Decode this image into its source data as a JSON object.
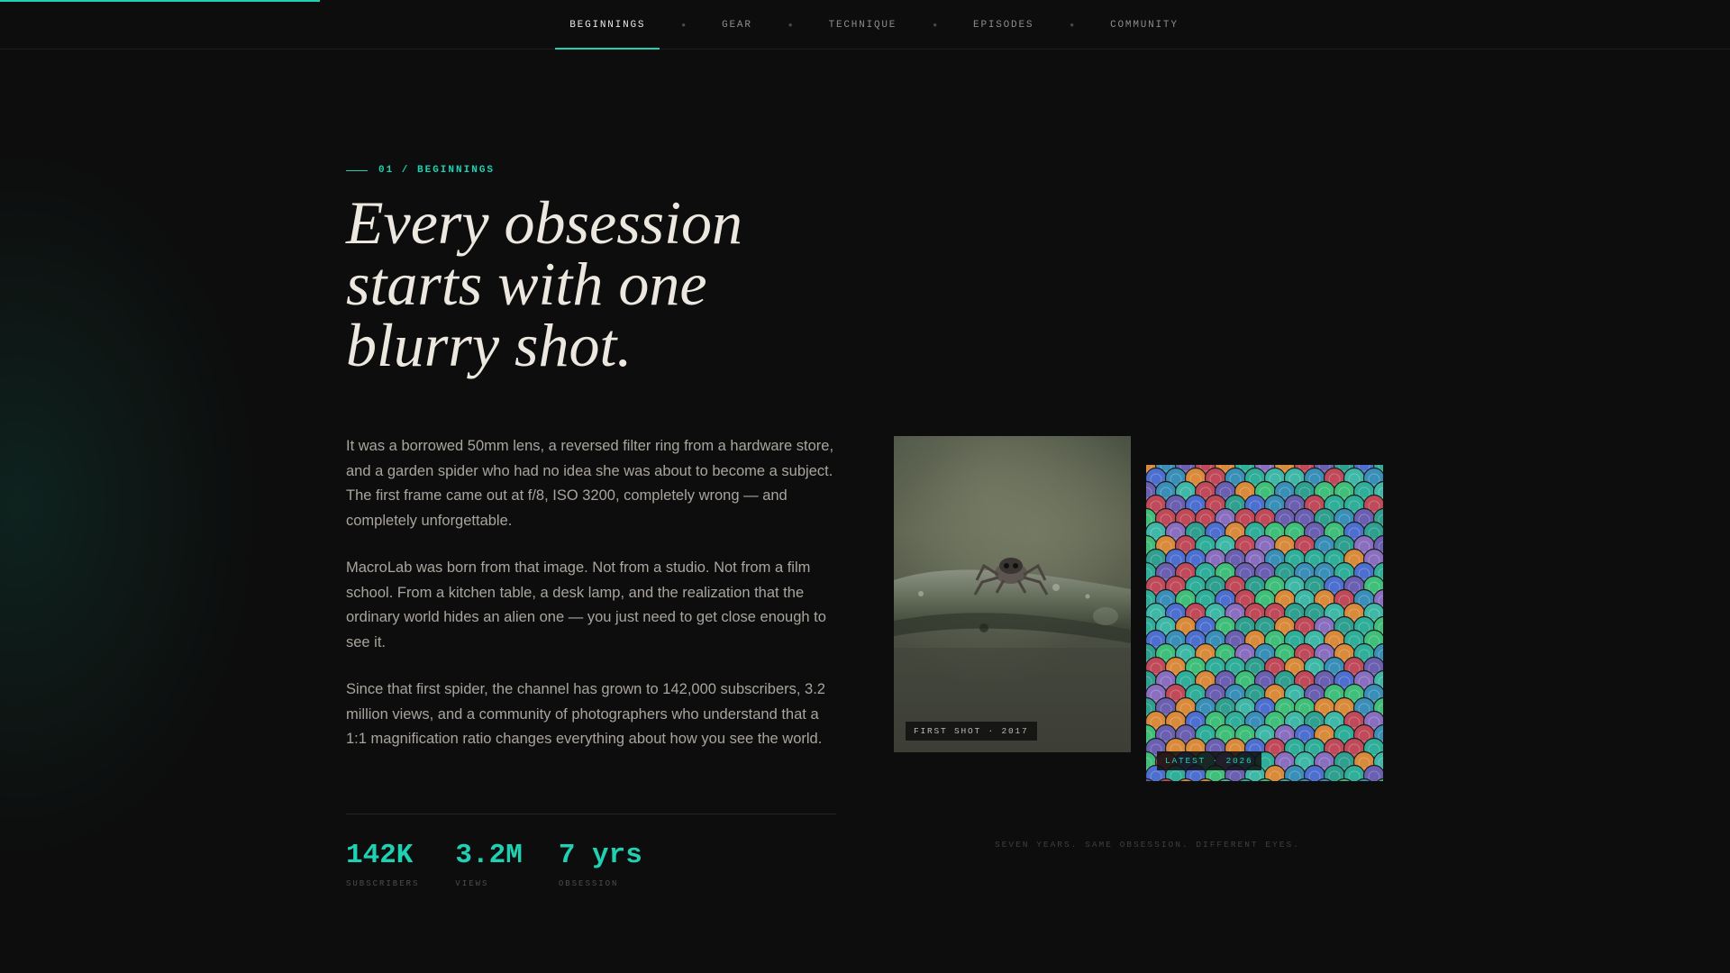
{
  "progress": {
    "fraction": 0.185,
    "color": "#1fd1b2"
  },
  "nav": {
    "items": [
      {
        "label": "BEGINNINGS",
        "active": true
      },
      {
        "label": "GEAR",
        "active": false
      },
      {
        "label": "TECHNIQUE",
        "active": false
      },
      {
        "label": "EPISODES",
        "active": false
      },
      {
        "label": "COMMUNITY",
        "active": false
      }
    ]
  },
  "hero": {
    "eyebrow": "01 / BEGINNINGS",
    "headline_lines": [
      "Every obsession",
      "starts with one",
      "blurry shot."
    ],
    "paragraphs": [
      "It was a borrowed 50mm lens, a reversed filter ring from a hardware store, and a garden spider who had no idea she was about to become a subject. The first frame came out at f/8, ISO 3200, completely wrong — and completely unforgettable.",
      "MacroLab was born from that image. Not from a studio. Not from a film school. From a kitchen table, a desk lamp, and the realization that the ordinary world hides an alien one — you just need to get close enough to see it.",
      "Since that first spider, the channel has grown to 142,000 subscribers, 3.2 million views, and a community of photographers who understand that a 1:1 magnification ratio changes everything about how you see the world."
    ]
  },
  "stats": [
    {
      "value": "142K",
      "label": "SUBSCRIBERS"
    },
    {
      "value": "3.2M",
      "label": "VIEWS"
    },
    {
      "value": "7 yrs",
      "label": "OBSESSION"
    }
  ],
  "photos": {
    "first_caption": "FIRST SHOT · 2017",
    "latest_caption": "LATEST · 2026",
    "footnote": "SEVEN YEARS. SAME OBSESSION. DIFFERENT EYES."
  },
  "colors": {
    "accent": "#1fd1b2",
    "background": "#0d0d0d",
    "headline": "#ece8df",
    "body": "#a9a59d"
  },
  "icons": {
    "nav_separator": "dot-separator-icon"
  }
}
